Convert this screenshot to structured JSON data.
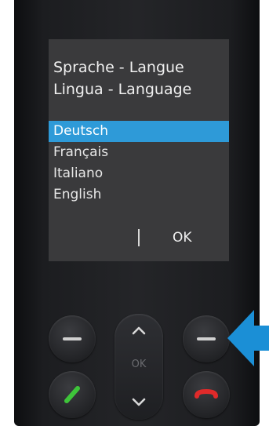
{
  "screen": {
    "title_line1": "Sprache - Langue",
    "title_line2": "Lingua - Language",
    "languages": [
      {
        "label": "Deutsch",
        "selected": true
      },
      {
        "label": "Français",
        "selected": false
      },
      {
        "label": "Italiano",
        "selected": false
      },
      {
        "label": "English",
        "selected": false
      }
    ],
    "softkey_right_label": "OK"
  },
  "keypad": {
    "nav_center_label": "OK",
    "call_icon": "green-handset-icon",
    "end_icon": "red-handset-icon",
    "softkey_icon": "minus-icon"
  },
  "callout": {
    "icon": "blue-arrow-pointing-left",
    "color": "#1b8fd6"
  },
  "colors": {
    "selection": "#2e9ad8",
    "call": "#3ec43a",
    "end": "#e02a2a"
  }
}
